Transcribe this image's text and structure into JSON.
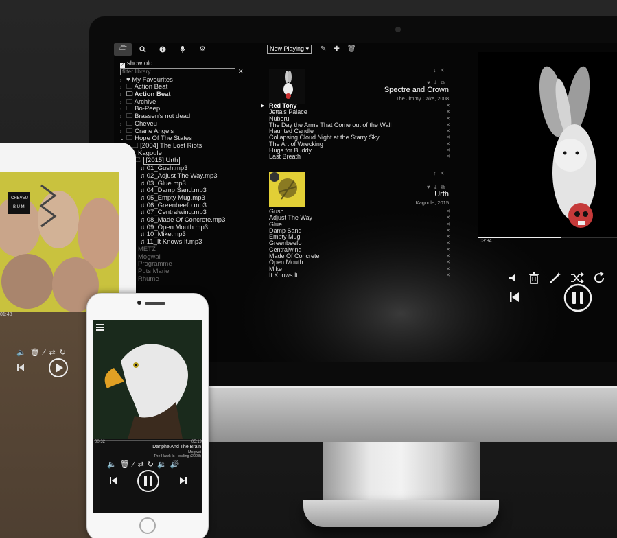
{
  "toolbar_left": {
    "icons": [
      "folder-icon",
      "search-icon",
      "info-icon",
      "mic-icon",
      "settings-icon"
    ]
  },
  "toolbar_right": {
    "select_value": "Now Playing ▾",
    "icons": [
      "edit-icon",
      "add-icon",
      "trash-icon"
    ]
  },
  "library": {
    "show_old_label": "show old",
    "filter_placeholder": "filter library",
    "clear": "✕",
    "favourites": "My Favourites",
    "folders": [
      "Action Beat",
      "Action Beat",
      "Archive",
      "Bo-Peep",
      "Brassen's not dead",
      "Cheveu",
      "Crane Angels",
      "Hope Of The States"
    ],
    "sub_folder": "[2004] The Lost Riots",
    "kagoule": "Kagoule",
    "urth_folder": "[2015] Urth",
    "files": [
      "01_Gush.mp3",
      "02_Adjust The Way.mp3",
      "03_Glue.mp3",
      "04_Damp Sand.mp3",
      "05_Empty Mug.mp3",
      "06_Greenbeefo.mp3",
      "07_Centralwing.mp3",
      "08_Made Of Concrete.mp3",
      "09_Open Mouth.mp3",
      "10_Mike.mp3",
      "11_It Knows It.mp3"
    ],
    "dim_items": [
      "METZ",
      "Mogwai",
      "Programme",
      "Puts Marie",
      "Rhume"
    ]
  },
  "playlist": {
    "album1": {
      "title": "Spectre and Crown",
      "sub": "The Jimmy Cake, 2008",
      "tracks": [
        "Red Tony",
        "Jetta's Palace",
        "Nuberu",
        "The Day the Arms That Come out of the Wall",
        "Haunted Candle",
        "Collapsing Cloud Night at the Starry Sky",
        "The Art of Wrecking",
        "Hugs for Buddy",
        "Last Breath"
      ]
    },
    "album2": {
      "title": "Urth",
      "sub": "Kagoule, 2015",
      "tracks": [
        "Gush",
        "Adjust The Way",
        "Glue",
        "Damp Sand",
        "Empty Mug",
        "Greenbeefo",
        "Centralwing",
        "Made Of Concrete",
        "Open Mouth",
        "Mike",
        "It Knows It"
      ]
    }
  },
  "desktop_player": {
    "elapsed": "03:34",
    "progress": 0.6
  },
  "tablet": {
    "album_text_1": "CHEVEU",
    "album_text_2": "B U M",
    "elapsed": "01:48"
  },
  "phone": {
    "elapsed": "00:32",
    "total": "05:19",
    "track": "Danphe And The Brain",
    "artist": "Mogwai",
    "album": "The Hawk Is Howling (2008)"
  }
}
